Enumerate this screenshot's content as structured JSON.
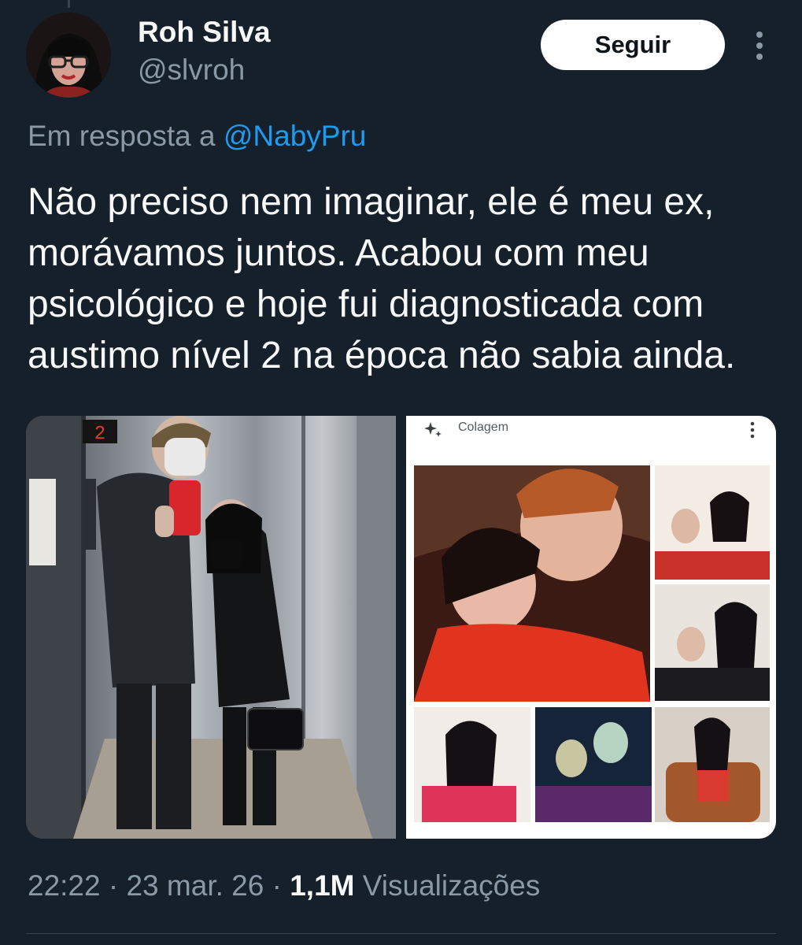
{
  "author": {
    "display_name": "Roh Silva",
    "handle": "@slvroh"
  },
  "follow_button": {
    "label": "Seguir"
  },
  "reply_context": {
    "prefix": "Em resposta a",
    "mention": "@NabyPru"
  },
  "tweet": {
    "text_lines": [
      "Não preciso nem imaginar, ele é meu ex,",
      "morávamos juntos. Acabou com meu",
      "psicológico e hoje fui diagnosticada com",
      "austimo nível 2 na época não sabia ainda."
    ]
  },
  "media": {
    "photo_1": {
      "elevator_display": "2"
    },
    "photo_2": {
      "collage_title": "Colagem"
    }
  },
  "meta": {
    "time": "22:22",
    "separator": "·",
    "date": "23 mar. 26",
    "views_count": "1,1M",
    "views_label": "Visualizações"
  },
  "colors": {
    "background": "#15202b",
    "text_primary": "#f7f9f9",
    "text_secondary": "#8b98a5",
    "link": "#1d9bf0",
    "follow_button_bg": "#ffffff",
    "follow_button_text": "#0f1419"
  },
  "icons": {
    "more": "more-vertical-icon",
    "sparkle": "sparkle-icon",
    "collage_menu": "more-vertical-icon"
  }
}
